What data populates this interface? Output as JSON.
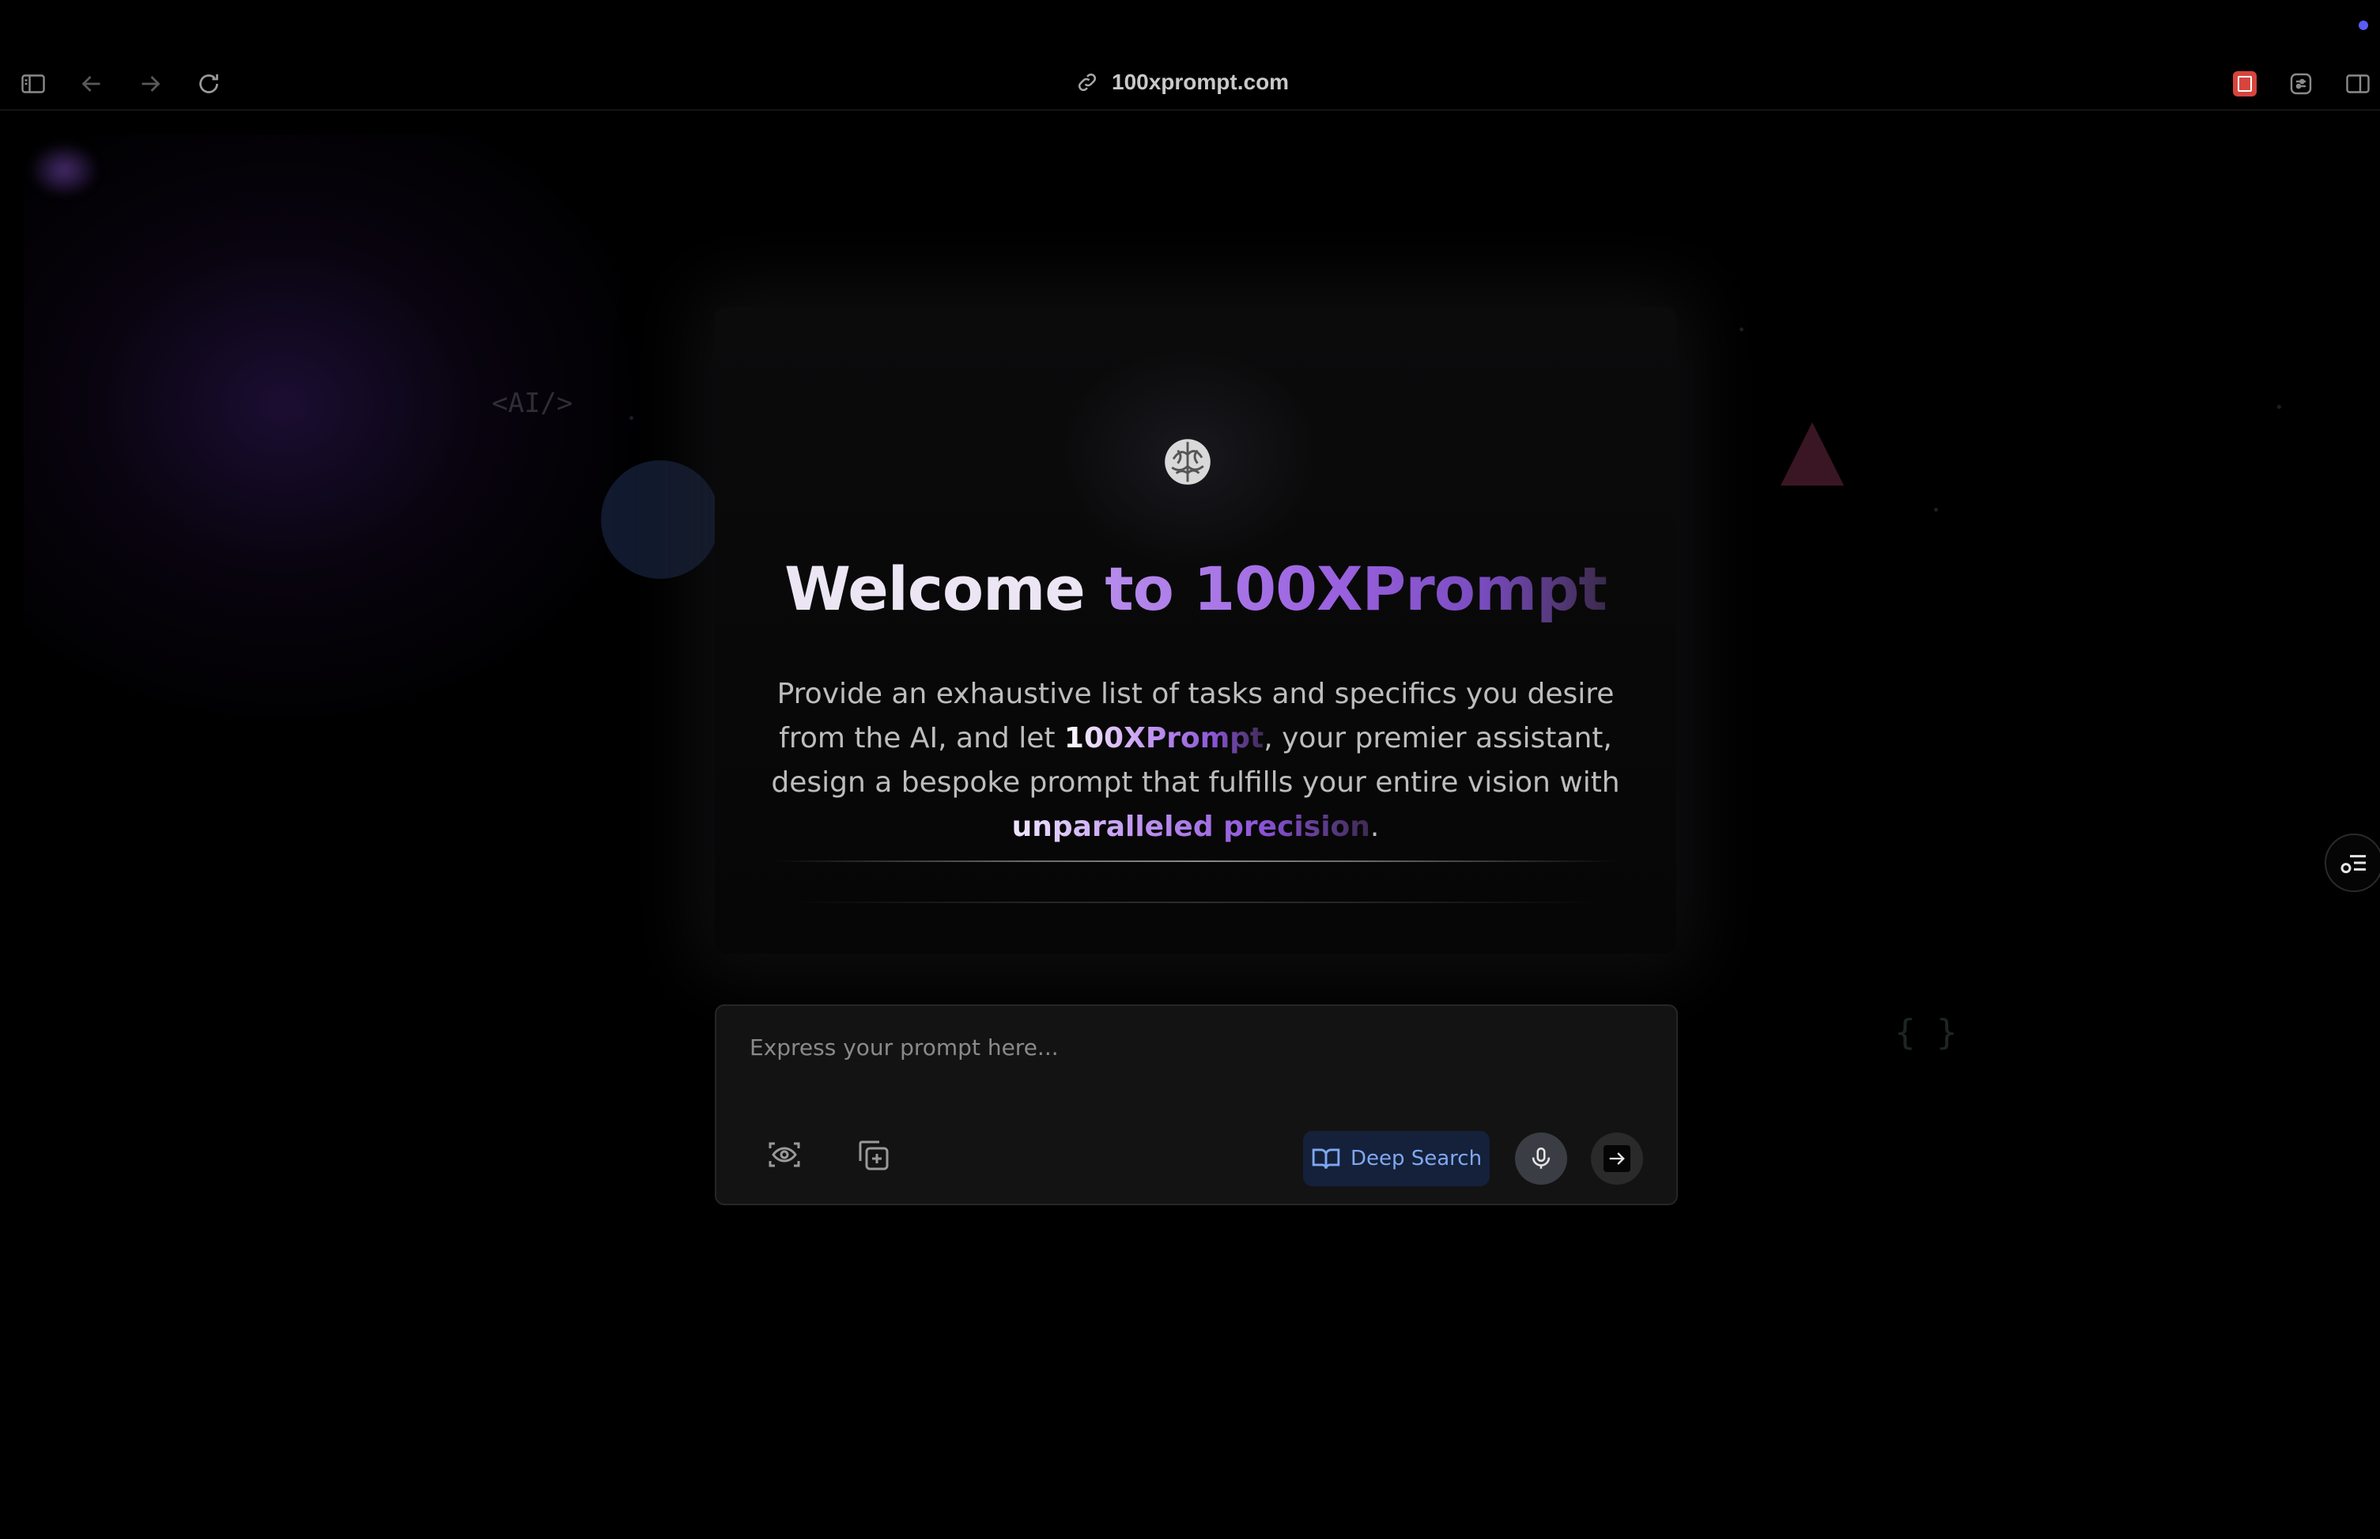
{
  "browser": {
    "url": "100xprompt.com",
    "icons": [
      "sidebar-toggle-icon",
      "back-arrow-icon",
      "forward-arrow-icon",
      "reload-icon",
      "link-icon",
      "pdf-extension-icon",
      "settings-sliders-icon",
      "split-view-icon"
    ]
  },
  "decor": {
    "ai_tag": "<AI/>",
    "braces": "{ }"
  },
  "welcome": {
    "title_part1": "Welcome ",
    "title_part2": "to 100XPrompt",
    "desc_part1": "Provide an exhaustive list of tasks and specifics you desire from the AI, and let ",
    "desc_brand": "100XPrompt",
    "desc_part2": ", your premier assistant, design a bespoke prompt that fulfills your entire vision with ",
    "desc_emphasis": "unparalleled precision",
    "desc_end": "."
  },
  "prompt_box": {
    "placeholder": "Express your prompt here...",
    "deep_search_label": "Deep Search"
  },
  "colors": {
    "accent_purple": "#9b62e0",
    "deep_search_bg": "#15213a",
    "deep_search_text": "#7ea8f2",
    "background": "#000000"
  }
}
